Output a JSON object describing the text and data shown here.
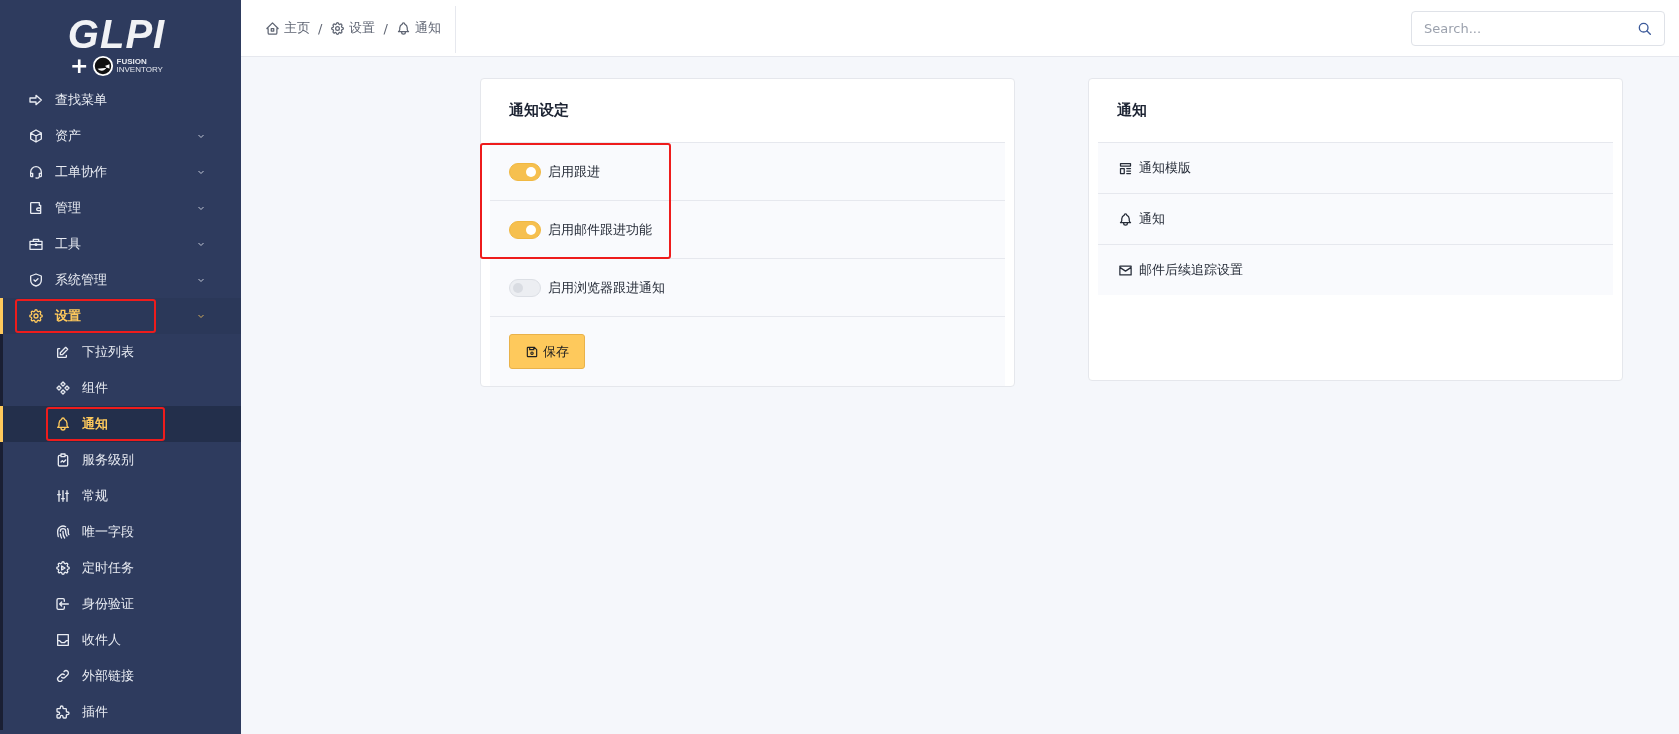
{
  "logo": {
    "title": "GLPI",
    "plus": "+",
    "brand_top": "FUSION",
    "brand_bottom": "INVENTORY"
  },
  "sidebar": {
    "items": [
      {
        "label": "查找菜单",
        "has_submenu": false,
        "selected": false,
        "highlighted": false
      },
      {
        "label": "资产",
        "has_submenu": true,
        "selected": false,
        "highlighted": false
      },
      {
        "label": "工单协作",
        "has_submenu": true,
        "selected": false,
        "highlighted": false
      },
      {
        "label": "管理",
        "has_submenu": true,
        "selected": false,
        "highlighted": false
      },
      {
        "label": "工具",
        "has_submenu": true,
        "selected": false,
        "highlighted": false
      },
      {
        "label": "系统管理",
        "has_submenu": true,
        "selected": false,
        "highlighted": false
      },
      {
        "label": "设置",
        "has_submenu": true,
        "selected": true,
        "highlighted": true,
        "children": [
          {
            "label": "下拉列表",
            "selected": false,
            "highlighted": false
          },
          {
            "label": "组件",
            "selected": false,
            "highlighted": false
          },
          {
            "label": "通知",
            "selected": true,
            "highlighted": true
          },
          {
            "label": "服务级别",
            "selected": false,
            "highlighted": false
          },
          {
            "label": "常规",
            "selected": false,
            "highlighted": false
          },
          {
            "label": "唯一字段",
            "selected": false,
            "highlighted": false
          },
          {
            "label": "定时任务",
            "selected": false,
            "highlighted": false
          },
          {
            "label": "身份验证",
            "selected": false,
            "highlighted": false
          },
          {
            "label": "收件人",
            "selected": false,
            "highlighted": false
          },
          {
            "label": "外部链接",
            "selected": false,
            "highlighted": false
          },
          {
            "label": "插件",
            "selected": false,
            "highlighted": false
          }
        ]
      }
    ]
  },
  "breadcrumb": [
    {
      "kind": "crumb",
      "label": "主页"
    },
    {
      "kind": "separator",
      "label": "/"
    },
    {
      "kind": "crumb",
      "label": "设置"
    },
    {
      "kind": "separator",
      "label": "/"
    },
    {
      "kind": "crumb",
      "label": "通知"
    }
  ],
  "search": {
    "placeholder": "Search..."
  },
  "settings_card": {
    "title": "通知设定",
    "toggles": [
      {
        "label": "启用跟进",
        "on": true,
        "highlighted": true
      },
      {
        "label": "启用邮件跟进功能",
        "on": true,
        "highlighted": true
      },
      {
        "label": "启用浏览器跟进通知",
        "on": false,
        "highlighted": false
      }
    ],
    "save_button": "保存"
  },
  "links_card": {
    "title": "通知",
    "links": [
      {
        "label": "通知模版"
      },
      {
        "label": "通知"
      },
      {
        "label": "邮件后续追踪设置"
      }
    ]
  }
}
